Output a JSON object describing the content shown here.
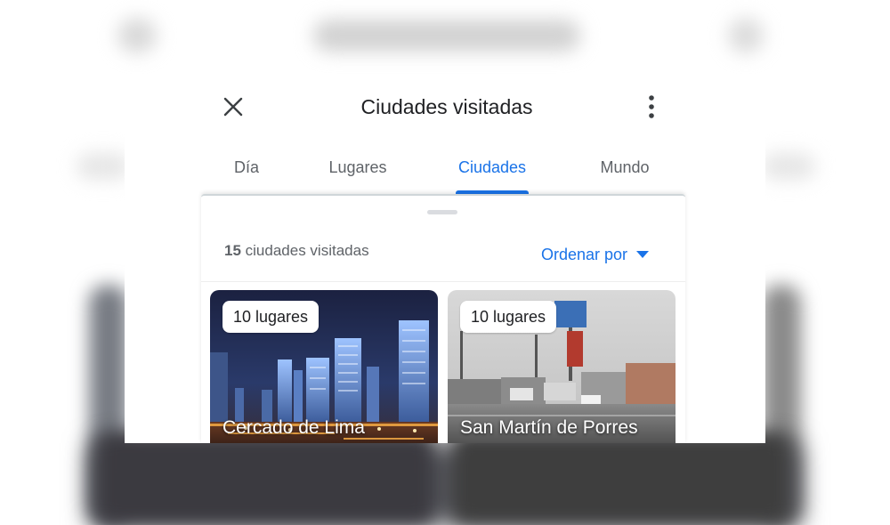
{
  "header": {
    "title": "Ciudades visitadas",
    "close_icon": "close-icon",
    "menu_icon": "more-vert-icon"
  },
  "tabs": [
    {
      "label": "Día",
      "active": false
    },
    {
      "label": "Lugares",
      "active": false
    },
    {
      "label": "Ciudades",
      "active": true
    },
    {
      "label": "Mundo",
      "active": false
    }
  ],
  "summary": {
    "count": "15",
    "label": "ciudades visitadas"
  },
  "sort": {
    "label": "Ordenar por",
    "icon": "arrow-drop-down-icon"
  },
  "cities": [
    {
      "name": "Cercado de Lima",
      "places": "10 lugares"
    },
    {
      "name": "San Martín de Porres",
      "places": "10 lugares"
    }
  ],
  "colors": {
    "accent": "#1a73e8",
    "text_primary": "#202124",
    "text_secondary": "#5f6368"
  }
}
